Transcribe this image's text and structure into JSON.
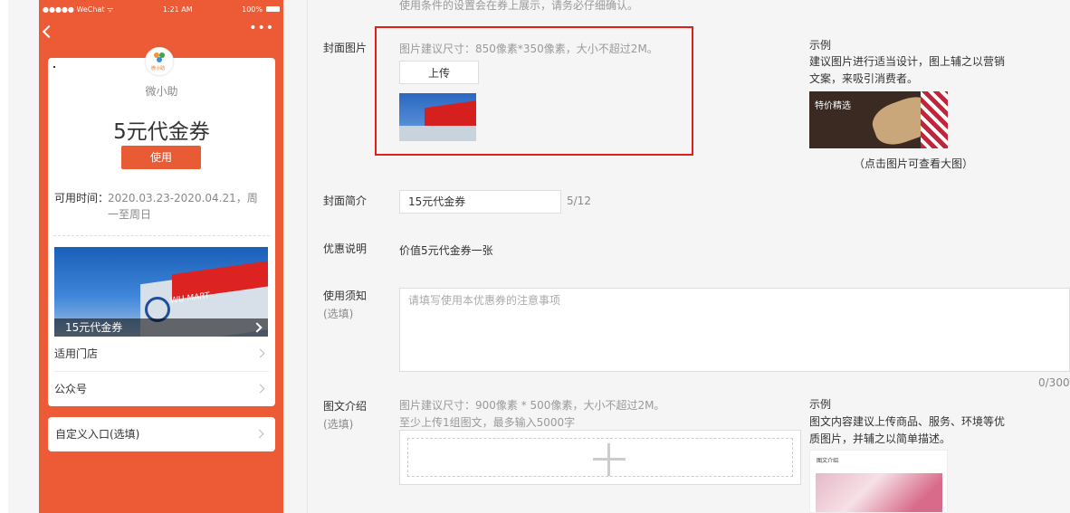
{
  "phone": {
    "status_left": "●●●●● WeChat ᯤ",
    "status_time": "1:21 AM",
    "status_battery": "100%",
    "more": "•••",
    "logo_text": "微小助",
    "shop_name": "微小助",
    "coupon_title": "5元代金券",
    "use_button": "使用",
    "time_label": "可用时间：",
    "time_value": "2020.03.23-2020.04.21，周一至周日",
    "cover_caption": "15元代金券",
    "cover_sign": "WU MART",
    "links": [
      "适用门店",
      "公众号"
    ],
    "custom_entry": "自定义入口(选填)"
  },
  "form": {
    "top_note": "使用条件的设置会在券上展示，请务必仔细确认。",
    "cover": {
      "label": "封面图片",
      "hint": "图片建议尺寸：850像素*350像素，大小不超过2M。",
      "upload_button": "上传",
      "example_title": "示例",
      "example_desc": "建议图片进行适当设计，图上辅之以营销文案，来吸引消费者。",
      "example_img_text": "特价精选",
      "example_caption": "（点击图片可查看大图）"
    },
    "summary": {
      "label": "封面简介",
      "value": "15元代金券",
      "counter": "5/12"
    },
    "discount": {
      "label": "优惠说明",
      "value": "价值5元代金券一张"
    },
    "notice": {
      "label": "使用须知",
      "sub": "(选填)",
      "placeholder": "请填写使用本优惠券的注意事项",
      "counter": "0/300"
    },
    "graphic": {
      "label": "图文介绍",
      "sub": "(选填)",
      "hint1": "图片建议尺寸：900像素 * 500像素，大小不超过2M。",
      "hint2": "至少上传1组图文，最多输入5000字",
      "example_title": "示例",
      "example_desc": "图文内容建议上传商品、服务、环境等优质图片，并辅之以简单描述。",
      "example_img_title": "图文介绍"
    }
  },
  "colors": {
    "brand": "#ec5b36",
    "highlight_box": "#e21d1d"
  }
}
